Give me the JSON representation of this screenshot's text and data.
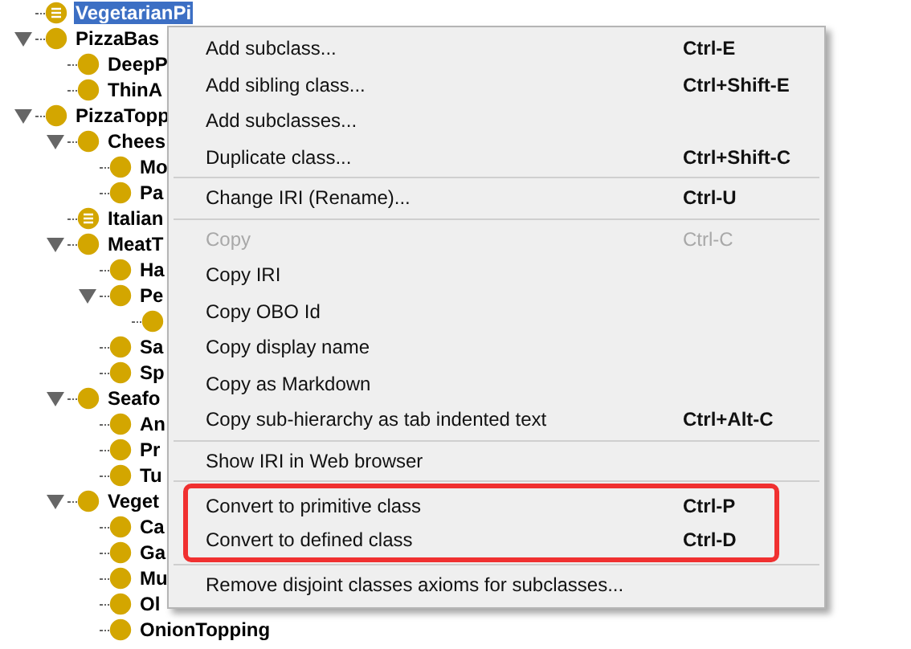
{
  "class_tree": [
    {
      "label": "VegetarianPi",
      "kind": "defined",
      "selected": true
    },
    {
      "label": "PizzaBas",
      "kind": "class",
      "selected": false,
      "expanded": true,
      "children": [
        {
          "label": "DeepP",
          "kind": "class",
          "selected": false
        },
        {
          "label": "ThinA",
          "kind": "class",
          "selected": false
        }
      ]
    },
    {
      "label": "PizzaTopp",
      "kind": "class",
      "selected": false,
      "expanded": true,
      "children": [
        {
          "label": "Chees",
          "kind": "class",
          "selected": false,
          "expanded": true,
          "children": [
            {
              "label": "Mo",
              "kind": "class",
              "selected": false
            },
            {
              "label": "Pa",
              "kind": "class",
              "selected": false
            }
          ]
        },
        {
          "label": "Italian",
          "kind": "defined",
          "selected": false
        },
        {
          "label": "MeatT",
          "kind": "class",
          "selected": false,
          "expanded": true,
          "children": [
            {
              "label": "Ha",
              "kind": "class",
              "selected": false
            },
            {
              "label": "Pe",
              "kind": "class",
              "selected": false,
              "expanded": true,
              "children": [
                {
                  "kind": "class",
                  "selected": false
                }
              ]
            },
            {
              "label": "Sa",
              "kind": "class",
              "selected": false
            },
            {
              "label": "Sp",
              "kind": "class",
              "selected": false
            }
          ]
        },
        {
          "label": "Seafo",
          "kind": "class",
          "selected": false,
          "expanded": true,
          "children": [
            {
              "label": "An",
              "kind": "class",
              "selected": false
            },
            {
              "label": "Pr",
              "kind": "class",
              "selected": false
            },
            {
              "label": "Tu",
              "kind": "class",
              "selected": false
            }
          ]
        },
        {
          "label": "Veget",
          "kind": "class",
          "selected": false,
          "expanded": true,
          "children": [
            {
              "label": "Ca",
              "kind": "class",
              "selected": false
            },
            {
              "label": "Ga",
              "kind": "class",
              "selected": false
            },
            {
              "label": "Mu",
              "kind": "class",
              "selected": false
            },
            {
              "label": "Ol",
              "kind": "class",
              "selected": false
            },
            {
              "label": "OnionTopping",
              "kind": "class",
              "selected": false
            }
          ]
        }
      ]
    }
  ],
  "context_menu": {
    "groups": [
      {
        "annotated": false,
        "items": [
          {
            "label": "Add subclass...",
            "shortcut": "Ctrl-E",
            "disabled": false
          },
          {
            "label": "Add sibling class...",
            "shortcut": "Ctrl+Shift-E",
            "disabled": false
          },
          {
            "label": "Add subclasses...",
            "disabled": false
          },
          {
            "label": "Duplicate class...",
            "shortcut": "Ctrl+Shift-C",
            "disabled": false
          }
        ]
      },
      {
        "annotated": false,
        "items": [
          {
            "label": "Change IRI (Rename)...",
            "shortcut": "Ctrl-U",
            "disabled": false
          }
        ]
      },
      {
        "annotated": false,
        "items": [
          {
            "label": "Copy",
            "shortcut": "Ctrl-C",
            "disabled": true
          },
          {
            "label": "Copy IRI",
            "disabled": false
          },
          {
            "label": "Copy OBO Id",
            "disabled": false
          },
          {
            "label": "Copy display name",
            "disabled": false
          },
          {
            "label": "Copy as Markdown",
            "disabled": false
          },
          {
            "label": "Copy sub-hierarchy as tab indented text",
            "shortcut": "Ctrl+Alt-C",
            "disabled": false
          }
        ]
      },
      {
        "annotated": false,
        "items": [
          {
            "label": "Show IRI in Web browser",
            "disabled": false
          }
        ]
      },
      {
        "annotated": true,
        "items": [
          {
            "label": "Convert to primitive class",
            "shortcut": "Ctrl-P",
            "disabled": false
          },
          {
            "label": "Convert to defined class",
            "shortcut": "Ctrl-D",
            "disabled": false
          }
        ]
      },
      {
        "annotated": false,
        "items": [
          {
            "label": "Remove disjoint classes axioms for subclasses...",
            "disabled": false
          }
        ]
      }
    ]
  }
}
